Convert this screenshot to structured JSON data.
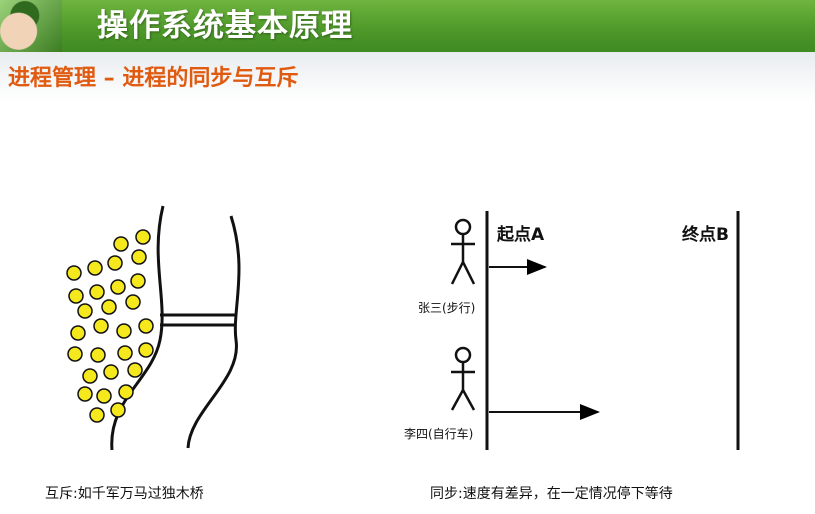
{
  "header": {
    "title": "操作系统基本原理"
  },
  "section": {
    "subtitle": "进程管理 – 进程的同步与互斥"
  },
  "diagram": {
    "mutex_caption": "互斥:如千军万马过独木桥",
    "sync_caption": "同步:速度有差异，在一定情况停下等待",
    "start_label": "起点A",
    "end_label": "终点B",
    "person1_label": "张三(步行)",
    "person2_label": "李四(自行车)"
  },
  "colors": {
    "header_green": "#4f9a2a",
    "subtitle_orange": "#e05a10",
    "dot_yellow": "#f5e81c"
  }
}
